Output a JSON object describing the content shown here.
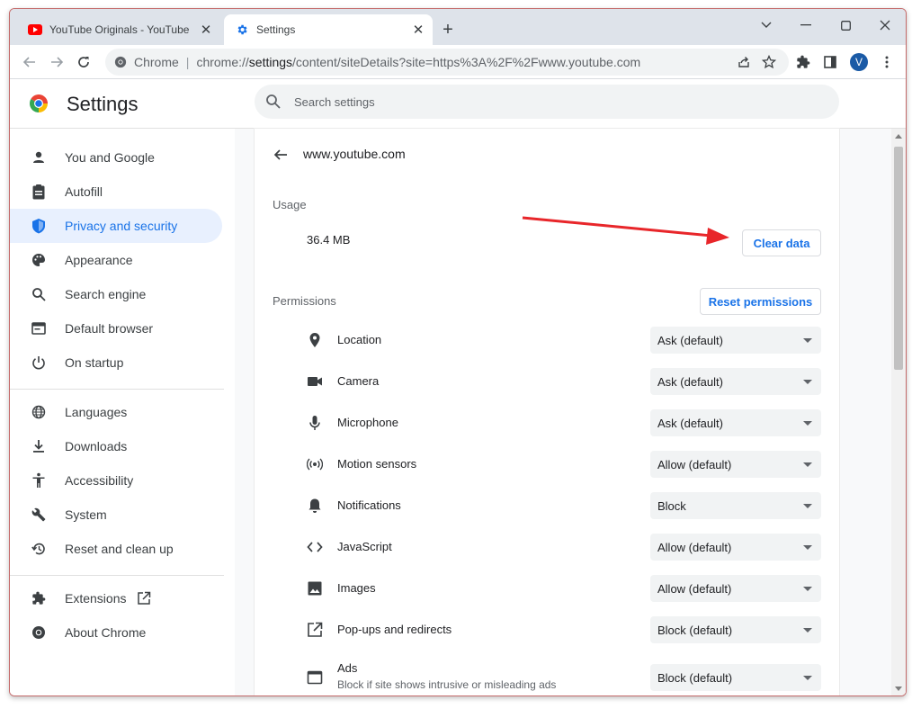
{
  "tabs": [
    {
      "title": "YouTube Originals - YouTube",
      "favicon": "youtube-icon"
    },
    {
      "title": "Settings",
      "favicon": "gear-icon"
    }
  ],
  "new_tab_label": "+",
  "window_controls": [
    "minimize-icon",
    "maximize-icon",
    "close-icon"
  ],
  "omnibox": {
    "chip": "Chrome",
    "separator": "|",
    "url_prefix": "chrome://",
    "url_host": "settings",
    "url_path": "/content/siteDetails?site=https%3A%2F%2Fwww.youtube.com"
  },
  "profile_initial": "V",
  "header": {
    "title": "Settings",
    "search_placeholder": "Search settings"
  },
  "sidebar": {
    "items": [
      {
        "label": "You and Google",
        "icon": "person-icon"
      },
      {
        "label": "Autofill",
        "icon": "clipboard-icon"
      },
      {
        "label": "Privacy and security",
        "icon": "shield-icon",
        "active": true
      },
      {
        "label": "Appearance",
        "icon": "palette-icon"
      },
      {
        "label": "Search engine",
        "icon": "search-icon"
      },
      {
        "label": "Default browser",
        "icon": "browser-icon"
      },
      {
        "label": "On startup",
        "icon": "power-icon"
      },
      {
        "label": "Languages",
        "icon": "globe-icon"
      },
      {
        "label": "Downloads",
        "icon": "download-icon"
      },
      {
        "label": "Accessibility",
        "icon": "accessibility-icon"
      },
      {
        "label": "System",
        "icon": "wrench-icon"
      },
      {
        "label": "Reset and clean up",
        "icon": "restore-icon"
      },
      {
        "label": "Extensions",
        "icon": "puzzle-icon"
      },
      {
        "label": "About Chrome",
        "icon": "chrome-icon"
      }
    ]
  },
  "site": {
    "host": "www.youtube.com",
    "usage_title": "Usage",
    "usage_value": "36.4 MB",
    "clear_data_label": "Clear data",
    "permissions_title": "Permissions",
    "reset_permissions_label": "Reset permissions"
  },
  "permissions": [
    {
      "label": "Location",
      "value": "Ask (default)",
      "icon": "location-icon"
    },
    {
      "label": "Camera",
      "value": "Ask (default)",
      "icon": "camera-icon"
    },
    {
      "label": "Microphone",
      "value": "Ask (default)",
      "icon": "microphone-icon"
    },
    {
      "label": "Motion sensors",
      "value": "Allow (default)",
      "icon": "motion-sensor-icon"
    },
    {
      "label": "Notifications",
      "value": "Block",
      "icon": "bell-icon"
    },
    {
      "label": "JavaScript",
      "value": "Allow (default)",
      "icon": "code-icon"
    },
    {
      "label": "Images",
      "value": "Allow (default)",
      "icon": "image-icon"
    },
    {
      "label": "Pop-ups and redirects",
      "value": "Block (default)",
      "icon": "open-in-new-icon"
    },
    {
      "label": "Ads",
      "sublabel": "Block if site shows intrusive or misleading ads",
      "value": "Block (default)",
      "icon": "ads-icon"
    }
  ],
  "colors": {
    "accent": "#1a73e8",
    "annotation_arrow": "#e8262a",
    "active_nav_bg": "#e8f0fe"
  }
}
